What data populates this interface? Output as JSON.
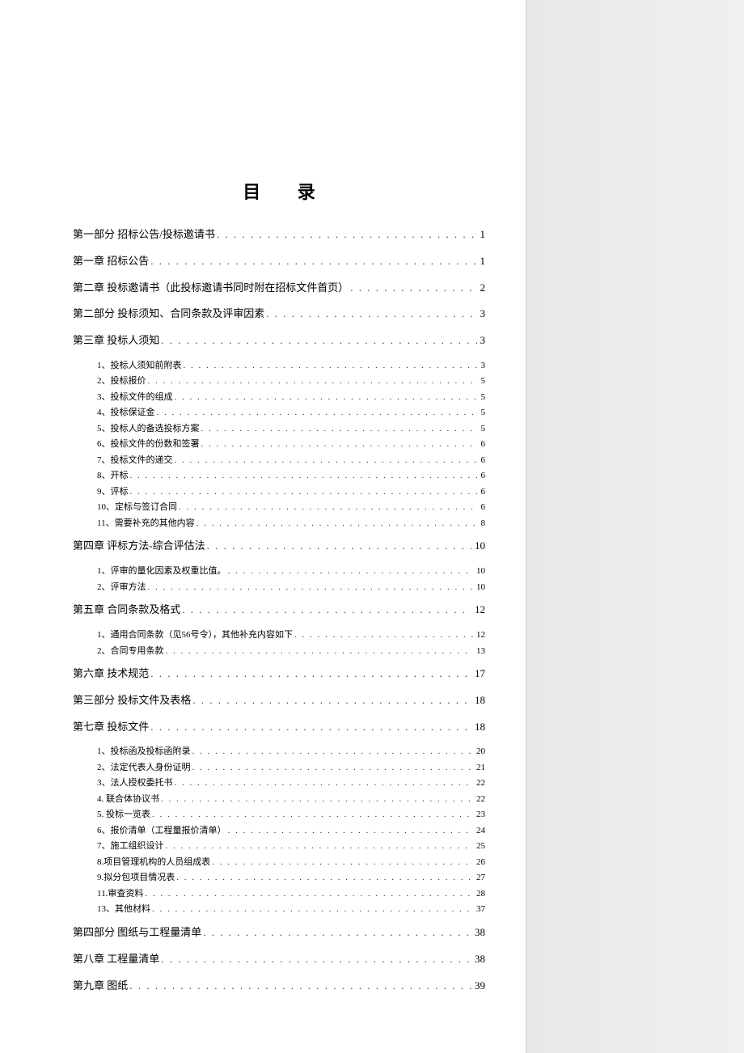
{
  "title": "目 录",
  "entries": [
    {
      "type": "main",
      "label": "第一部分 招标公告/投标邀请书",
      "page": "1"
    },
    {
      "type": "main",
      "label": "第一章 招标公告",
      "page": "1"
    },
    {
      "type": "main",
      "label": "第二章 投标邀请书（此投标邀请书同时附在招标文件首页）",
      "page": "2"
    },
    {
      "type": "main",
      "label": "第二部分 投标须知、合同条款及评审因素",
      "page": "3"
    },
    {
      "type": "main",
      "label": "第三章 投标人须知",
      "page": "3"
    },
    {
      "type": "group",
      "items": [
        {
          "label": "1、投标人须知前附表",
          "page": "3"
        },
        {
          "label": "2、投标报价",
          "page": "5"
        },
        {
          "label": "3、投标文件的组成",
          "page": "5"
        },
        {
          "label": "4、投标保证金",
          "page": "5"
        },
        {
          "label": "5、投标人的备选投标方案",
          "page": "5"
        },
        {
          "label": "6、投标文件的份数和签署",
          "page": "6"
        },
        {
          "label": "7、投标文件的递交",
          "page": "6"
        },
        {
          "label": "8、开标",
          "page": "6"
        },
        {
          "label": "9、评标",
          "page": "6"
        },
        {
          "label": "10、定标与签订合同",
          "page": "6"
        },
        {
          "label": "11、需要补充的其他内容",
          "page": "8"
        }
      ]
    },
    {
      "type": "main",
      "label": "第四章 评标方法-综合评估法",
      "page": "10"
    },
    {
      "type": "group",
      "items": [
        {
          "label": "1、评审的量化因素及权重比值。",
          "page": "10"
        },
        {
          "label": "2、评审方法",
          "page": "10"
        }
      ]
    },
    {
      "type": "main",
      "label": "第五章 合同条款及格式",
      "page": "12"
    },
    {
      "type": "group",
      "items": [
        {
          "label": "1、通用合同条款（见56号令），其他补充内容如下",
          "page": "12"
        },
        {
          "label": "2、合同专用条款",
          "page": "13"
        }
      ]
    },
    {
      "type": "main",
      "label": "第六章 技术规范",
      "page": "17"
    },
    {
      "type": "main",
      "label": "第三部分 投标文件及表格",
      "page": "18"
    },
    {
      "type": "main",
      "label": "第七章 投标文件",
      "page": "18"
    },
    {
      "type": "group",
      "items": [
        {
          "label": "1、投标函及投标函附录",
          "page": "20"
        },
        {
          "label": "2、法定代表人身份证明",
          "page": "21"
        },
        {
          "label": "3、法人授权委托书",
          "page": "22"
        },
        {
          "label": "4. 联合体协议书",
          "page": "22"
        },
        {
          "label": "5. 投标一览表",
          "page": "23"
        },
        {
          "label": "6、报价清单（工程量报价清单）",
          "page": "24"
        },
        {
          "label": "7、施工组织设计",
          "page": "25"
        },
        {
          "label": "8.项目管理机构的人员组成表",
          "page": "26"
        },
        {
          "label": "9.拟分包项目情况表",
          "page": "27"
        },
        {
          "label": "11.审查资料",
          "page": "28"
        },
        {
          "label": "13、其他材料",
          "page": "37"
        }
      ]
    },
    {
      "type": "main",
      "label": "第四部分 图纸与工程量清单",
      "page": "38"
    },
    {
      "type": "main",
      "label": "第八章 工程量清单",
      "page": "38"
    },
    {
      "type": "main",
      "label": "第九章 图纸",
      "page": "39"
    }
  ],
  "dots": ". . . . . . . . . . . . . . . . . . . . . . . . . . . . . . . . . . . . . . . . . . . . . . . . . . . . . . . . . . . . . . . . . . . . . . . . . . . . . . . . . . . . . . . . . . . . . . . . . . . ."
}
